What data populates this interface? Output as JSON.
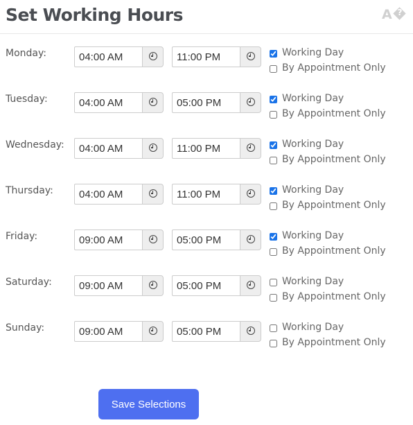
{
  "header": {
    "title": "Set Working Hours",
    "translate_icon": "translate-icon",
    "translate_glyph": "A",
    "translate_q": "?"
  },
  "labels": {
    "working_day": "Working Day",
    "by_appointment": "By Appointment Only"
  },
  "days": [
    {
      "label": "Monday:",
      "start": "04:00 AM",
      "end": "11:00 PM",
      "working_day": true,
      "by_appointment": false
    },
    {
      "label": "Tuesday:",
      "start": "04:00 AM",
      "end": "05:00 PM",
      "working_day": true,
      "by_appointment": false
    },
    {
      "label": "Wednesday:",
      "start": "04:00 AM",
      "end": "11:00 PM",
      "working_day": true,
      "by_appointment": false
    },
    {
      "label": "Thursday:",
      "start": "04:00 AM",
      "end": "11:00 PM",
      "working_day": true,
      "by_appointment": false
    },
    {
      "label": "Friday:",
      "start": "09:00 AM",
      "end": "05:00 PM",
      "working_day": true,
      "by_appointment": false
    },
    {
      "label": "Saturday:",
      "start": "09:00 AM",
      "end": "05:00 PM",
      "working_day": false,
      "by_appointment": false
    },
    {
      "label": "Sunday:",
      "start": "09:00 AM",
      "end": "05:00 PM",
      "working_day": false,
      "by_appointment": false
    }
  ],
  "icons": {
    "time_addon": "clock-icon"
  },
  "actions": {
    "save_label": "Save Selections"
  },
  "colors": {
    "accent": "#4e6ff0",
    "checkbox": "#1a73e8",
    "title": "#4a4d52"
  }
}
